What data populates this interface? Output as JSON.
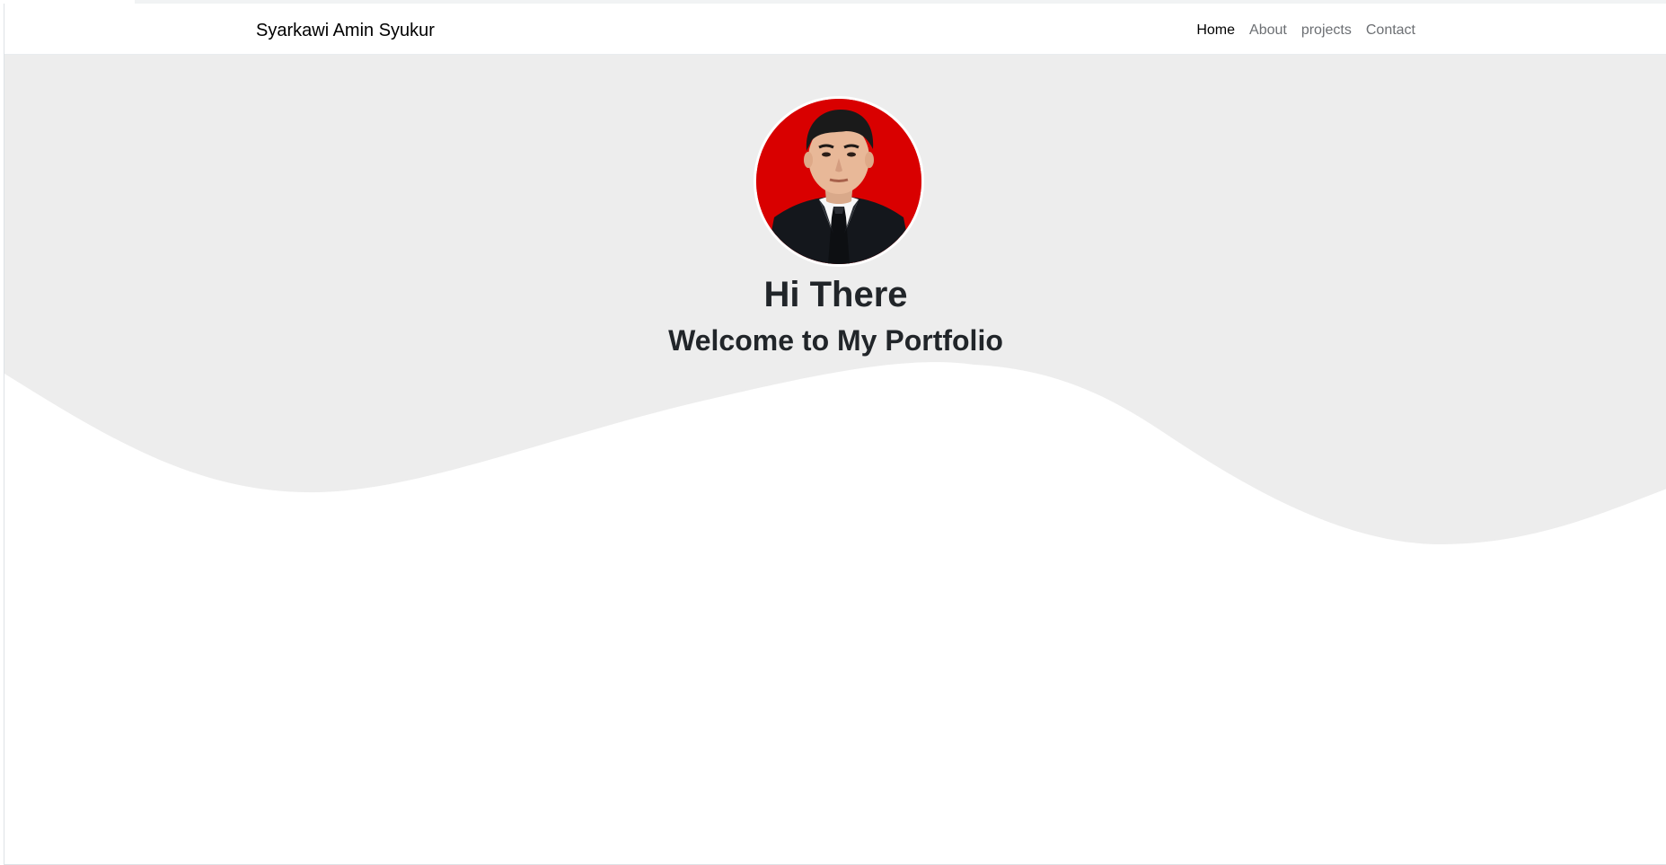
{
  "navbar": {
    "brand": "Syarkawi Amin Syukur",
    "links": [
      {
        "label": "Home",
        "active": true
      },
      {
        "label": "About",
        "active": false
      },
      {
        "label": "projects",
        "active": false
      },
      {
        "label": "Contact",
        "active": false
      }
    ]
  },
  "hero": {
    "greeting": "Hi There",
    "subtitle": "Welcome to My Portfolio",
    "avatar_icon": "profile-photo",
    "background_color": "#ededed",
    "avatar_background": "#d90000"
  }
}
